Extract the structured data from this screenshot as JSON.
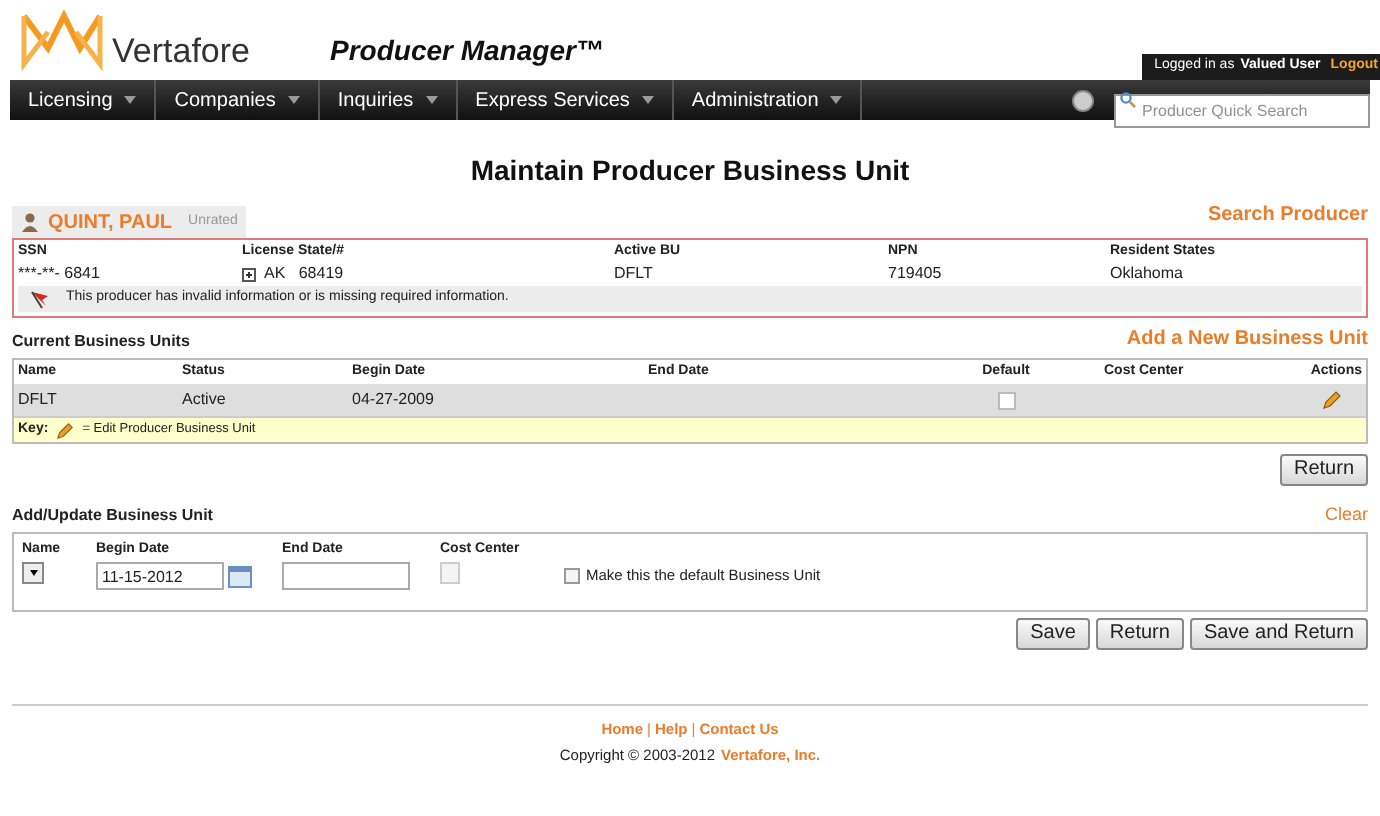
{
  "header": {
    "brand": "Vertafore",
    "product": "Producer Manager™",
    "login_prefix": "Logged in as",
    "user": "Valued User",
    "logout": "Logout"
  },
  "nav": {
    "items": [
      {
        "label": "Licensing"
      },
      {
        "label": "Companies"
      },
      {
        "label": "Inquiries"
      },
      {
        "label": "Express Services"
      },
      {
        "label": "Administration"
      }
    ],
    "search_placeholder": "Producer Quick Search"
  },
  "page_title": "Maintain Producer Business Unit",
  "producer": {
    "name": "QUINT, PAUL",
    "rating": "Unrated",
    "search_link": "Search Producer",
    "fields": [
      {
        "label": "SSN",
        "value": "***-**- 6841"
      },
      {
        "label": "License State/#",
        "value": "AK   68419",
        "expandable": true
      },
      {
        "label": "Active BU",
        "value": "DFLT"
      },
      {
        "label": "NPN",
        "value": "719405"
      },
      {
        "label": "Resident States",
        "value": "Oklahoma"
      }
    ],
    "warning": "This producer has invalid information or is missing required information."
  },
  "current_units": {
    "title": "Current Business Units",
    "add_link": "Add a New Business Unit",
    "columns": [
      "Name",
      "Status",
      "Begin Date",
      "End Date",
      "Default",
      "Cost Center",
      "Actions"
    ],
    "rows": [
      {
        "name": "DFLT",
        "status": "Active",
        "begin_date": "04-27-2009",
        "end_date": "",
        "default": false,
        "cost_center": ""
      }
    ],
    "key_label": "Key:",
    "key_text": "= Edit Producer Business Unit",
    "return_button": "Return"
  },
  "form": {
    "title": "Add/Update Business Unit",
    "clear_link": "Clear",
    "name_label": "Name",
    "begin_label": "Begin Date",
    "begin_value": "11-15-2012",
    "end_label": "End Date",
    "cost_label": "Cost Center",
    "default_checkbox": {
      "label": "Make this the default Business Unit",
      "checked": false
    },
    "buttons": [
      "Save",
      "Return",
      "Save and Return"
    ]
  },
  "footer": {
    "links": [
      "Home",
      "Help",
      "Contact Us"
    ],
    "separator": "|",
    "copyright": "Copyright © 2003-2012",
    "company": "Vertafore, Inc."
  }
}
